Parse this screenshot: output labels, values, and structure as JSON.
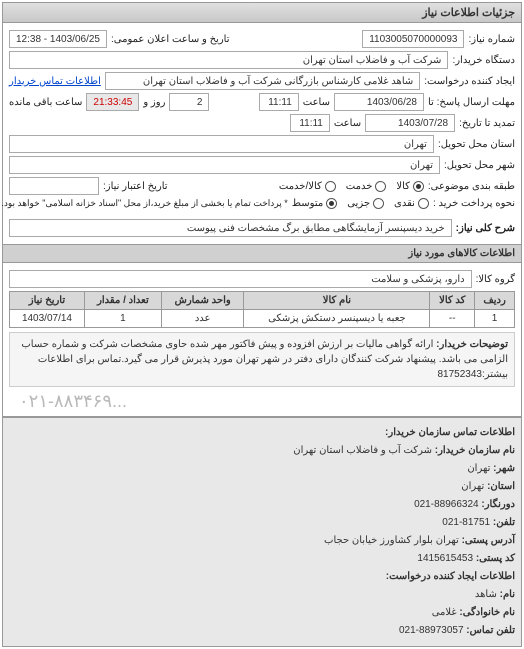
{
  "panel_title": "جزئیات اطلاعات نیاز",
  "fields": {
    "need_number_label": "شماره نیاز:",
    "need_number": "1103005070000093",
    "announce_label": "تاریخ و ساعت اعلان عمومی:",
    "announce_value": "1403/06/25 - 12:38",
    "buyer_device_label": "دستگاه خریدار:",
    "buyer_device": "شرکت آب و فاضلاب استان تهران",
    "requester_label": "ایجاد کننده درخواست:",
    "requester": "شاهد غلامی کارشناس بازرگانی شرکت آب و فاضلاب استان تهران",
    "contact_link": "اطلاعات تماس خریدار",
    "deadline_label": "مهلت ارسال پاسخ: تا",
    "deadline_date": "1403/06/28",
    "time_label": "ساعت",
    "deadline_time": "11:11",
    "days_and_label": "روز و",
    "days_remain": "2",
    "time_remain": "21:33:45",
    "time_remain_label": "ساعت باقی مانده",
    "extend_label": "تمدید تا تاریخ:",
    "extend_date": "1403/07/28",
    "extend_time": "11:11",
    "delivery_province_label": "استان محل تحویل:",
    "delivery_province": "تهران",
    "delivery_city_label": "شهر محل تحویل:",
    "delivery_city": "تهران",
    "category_label": "طبقه بندی موضوعی:",
    "cat_goods": "کالا",
    "cat_service": "خدمت",
    "cat_credit": "کالا/خدمت",
    "credit_date_label": "تاریخ اعتبار نیاز:",
    "payment_label": "نحوه پرداخت خرید :",
    "pay_cash": "نقدی",
    "pay_partial": "جزیی",
    "pay_mid": "متوسط",
    "pay_note": "* پرداخت تمام یا بخشی از مبلغ خرید،از محل \"اسناد خزانه اسلامی\" خواهد بود.",
    "desc_label": "شرح کلی نیاز:",
    "desc_value": "خرید دیسپنسر آزمایشگاهی مطابق برگ مشخصات فنی پیوست"
  },
  "goods_section_title": "اطلاعات کالاهای مورد نیاز",
  "goods_group_label": "گروه کالا:",
  "goods_group": "دارو، پزشکی و سلامت",
  "table": {
    "headers": [
      "ردیف",
      "کد کالا",
      "نام کالا",
      "واحد شمارش",
      "تعداد / مقدار",
      "تاریخ نیاز"
    ],
    "row": [
      "1",
      "--",
      "جعبه یا دیسپنسر دستکش پزشکی",
      "عدد",
      "1",
      "1403/07/14"
    ]
  },
  "notes": {
    "label": "توضیحات خریدار:",
    "text": "ارائه گواهی مالیات بر ارزش افزوده و پیش فاکتور مهر شده حاوی مشخصات شرکت و شماره حساب الزامی می باشد. پیشنهاد شرکت کنندگان دارای دفتر در شهر تهران مورد پذیرش قرار می گیرد.تماس برای اطلاعات بیشتر:81752343"
  },
  "watermark": "۰۲۱-۸۸۳۴۶۹...",
  "contact": {
    "title": "اطلاعات تماس سازمان خریدار:",
    "org_label": "نام سازمان خریدار:",
    "org": "شرکت آب و فاضلاب استان تهران",
    "city_label": "شهر:",
    "city": "تهران",
    "province_label": "استان:",
    "province": "تهران",
    "fax_label": "دورنگار:",
    "fax": "88966324-021",
    "phone_label": "تلفن:",
    "phone": "81751-021",
    "address_label": "آدرس پستی:",
    "address": "تهران بلوار کشاورز خیابان حجاب",
    "postal_label": "کد پستی:",
    "postal": "1415615453",
    "creator_section": "اطلاعات ایجاد کننده درخواست:",
    "name_label": "نام:",
    "name": "شاهد",
    "lastname_label": "نام خانوادگی:",
    "lastname": "غلامی",
    "contact_phone_label": "تلفن تماس:",
    "contact_phone": "88973057-021"
  }
}
